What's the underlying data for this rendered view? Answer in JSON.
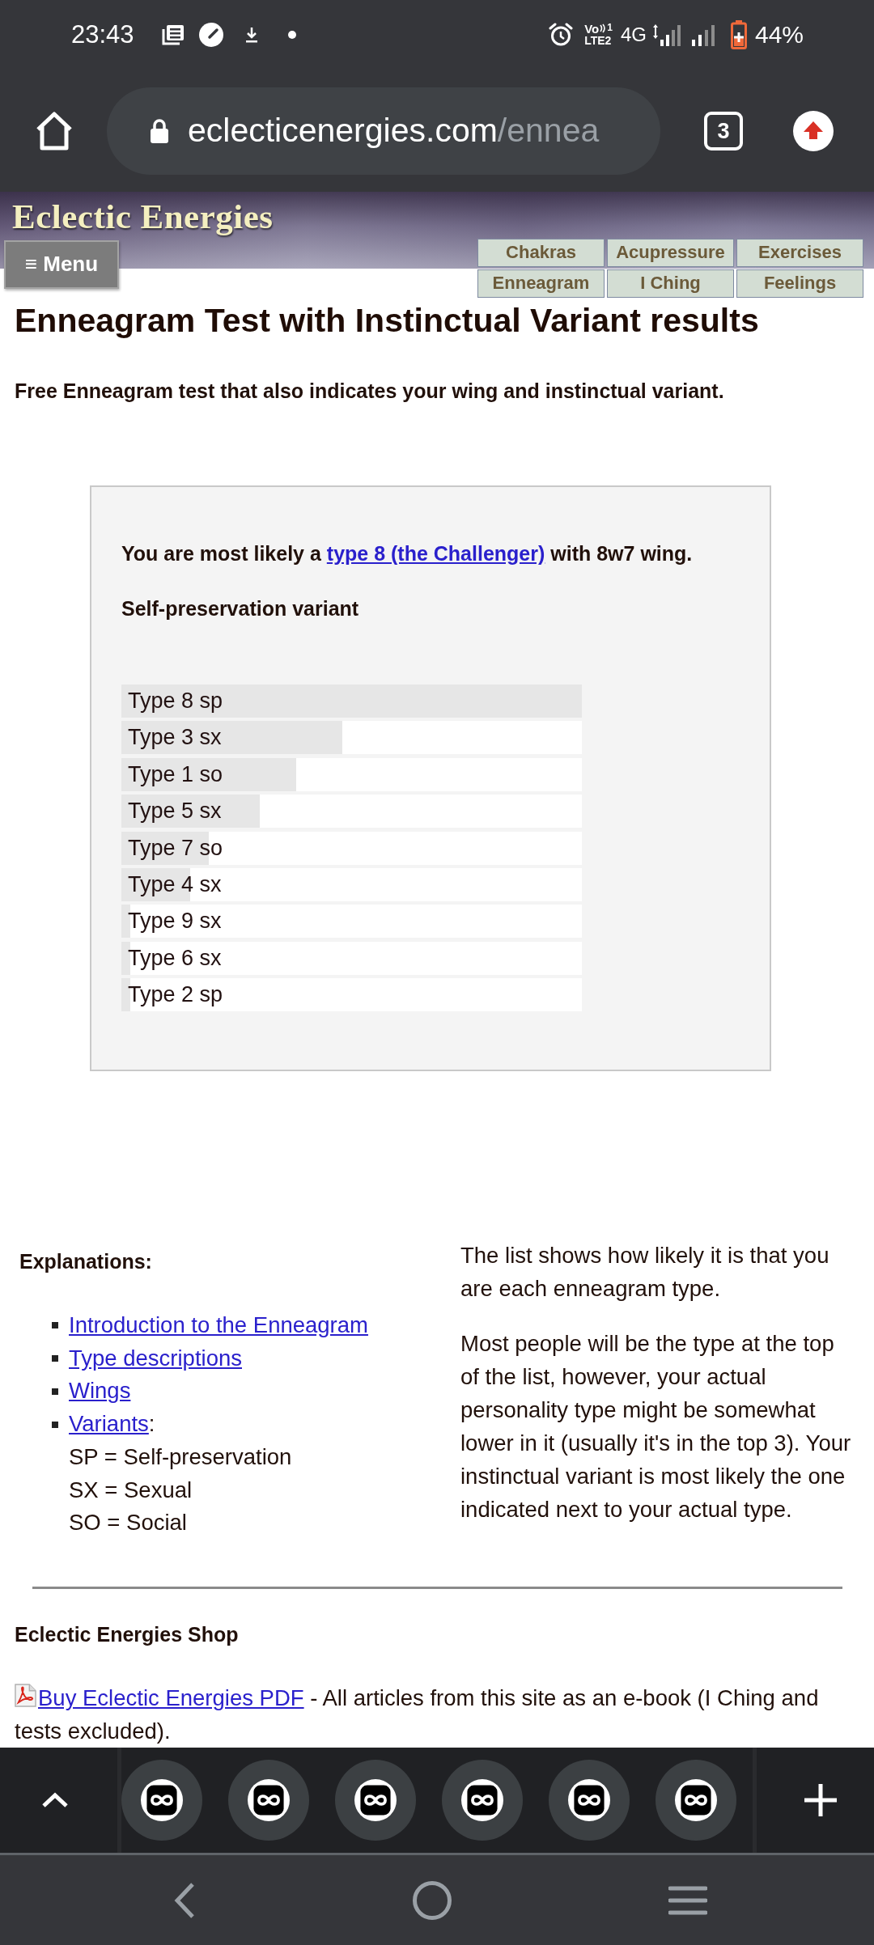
{
  "status_bar": {
    "time": "23:43",
    "volte": {
      "label": "Vo",
      "sim": "1",
      "lte": "LTE2"
    },
    "network": "4G",
    "battery": "44%"
  },
  "toolbar": {
    "url_host": "eclecticenergies.com",
    "url_path": "/ennea",
    "tab_count": "3"
  },
  "site_header": {
    "title": "Eclectic Energies",
    "menu_button": "≡ Menu",
    "nav_links": [
      "Chakras",
      "Acupressure",
      "Exercises",
      "Enneagram",
      "I Ching",
      "Feelings"
    ]
  },
  "page": {
    "heading": "Enneagram Test with Instinctual Variant results",
    "intro": "Free Enneagram test that also indicates your wing and instinctual variant."
  },
  "result": {
    "summary_before": "You are most likely a",
    "summary_link": "type 8 (the Challenger)",
    "summary_after": "with 8w7 wing.",
    "variant": "Self-preservation variant",
    "bars": [
      {
        "label": "Type 8 sp",
        "level": 1.0
      },
      {
        "label": "Type 3 sx",
        "level": 0.48
      },
      {
        "label": "Type 1 so",
        "level": 0.38
      },
      {
        "label": "Type 5 sx",
        "level": 0.3
      },
      {
        "label": "Type 7 so",
        "level": 0.19
      },
      {
        "label": "Type 4 sx",
        "level": 0.15
      },
      {
        "label": "Type 9 sx",
        "level": 0.02
      },
      {
        "label": "Type 6 sx",
        "level": 0.02
      },
      {
        "label": "Type 2 sp",
        "level": 0.02
      }
    ]
  },
  "explanations": {
    "title": "Explanations:",
    "links": [
      {
        "text": "Introduction to the Enneagram"
      },
      {
        "text": "Type descriptions"
      },
      {
        "text": "Wings"
      },
      {
        "text": "Variants",
        "suffix": ":"
      }
    ],
    "legend": [
      "SP = Self-preservation",
      "SX = Sexual",
      "SO = Social"
    ],
    "paragraphs": [
      "The list shows how likely it is that you are each enneagram type.",
      "Most people will be the type at the top of the list, however, your actual personality type might be somewhat lower in it (usually it's in the top 3). Your instinctual variant is most likely the one indicated next to your actual type."
    ]
  },
  "shop": {
    "title": "Eclectic Energies Shop",
    "link": "Buy Eclectic Energies PDF",
    "text": "- All articles from this site as an e-book (I Ching and tests excluded)."
  }
}
